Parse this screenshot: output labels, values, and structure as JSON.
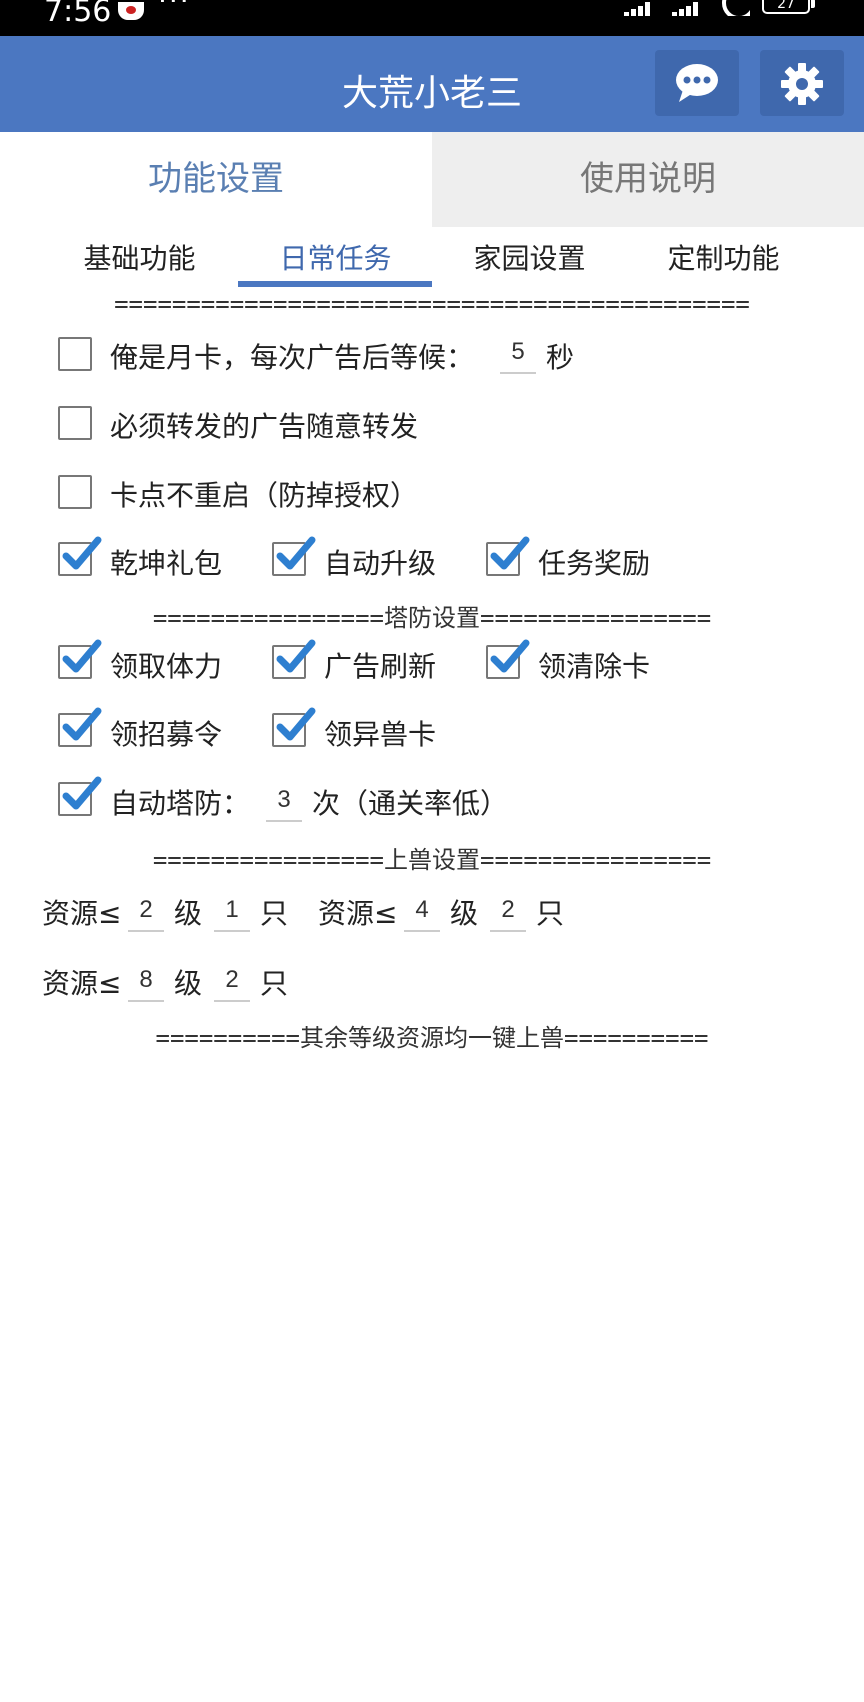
{
  "status": {
    "time": "7:56",
    "more": "···",
    "battery": "27"
  },
  "app": {
    "title": "大荒小老三",
    "chat_icon": "chat-bubble-icon",
    "settings_icon": "gear-icon"
  },
  "colors": {
    "app_bar": "#4b77c1",
    "accent": "#4b77c1",
    "check": "#2e7fd0"
  },
  "top_tabs": [
    {
      "label": "功能设置",
      "active": true
    },
    {
      "label": "使用说明",
      "active": false
    }
  ],
  "sub_tabs": [
    {
      "label": "基础功能",
      "active": false
    },
    {
      "label": "日常任务",
      "active": true
    },
    {
      "label": "家园设置",
      "active": false
    },
    {
      "label": "定制功能",
      "active": false
    }
  ],
  "separator_top": "============================================",
  "options": {
    "monthly_card": {
      "label": "俺是月卡，每次广告后等候：",
      "value": "5",
      "unit": "秒",
      "checked": false
    },
    "forward_ads": {
      "label": "必须转发的广告随意转发",
      "checked": false
    },
    "no_restart": {
      "label": "卡点不重启（防掉授权）",
      "checked": false
    },
    "qiankun": {
      "label": "乾坤礼包",
      "checked": true
    },
    "auto_upgrade": {
      "label": "自动升级",
      "checked": true
    },
    "task_reward": {
      "label": "任务奖励",
      "checked": true
    }
  },
  "tower_separator": "================塔防设置================",
  "tower": {
    "stamina": {
      "label": "领取体力",
      "checked": true
    },
    "ad_refresh": {
      "label": "广告刷新",
      "checked": true
    },
    "clear_card": {
      "label": "领清除卡",
      "checked": true
    },
    "recruit": {
      "label": "领招募令",
      "checked": true
    },
    "beast_card": {
      "label": "领异兽卡",
      "checked": true
    },
    "auto_tower": {
      "label": "自动塔防：",
      "value": "3",
      "unit": "次（通关率低）",
      "checked": true
    }
  },
  "beast_separator": "================上兽设置================",
  "beast": {
    "res_label": "资源≤",
    "level_unit": "级",
    "count_unit": "只",
    "row1": [
      {
        "level": "2",
        "count": "1"
      },
      {
        "level": "4",
        "count": "2"
      }
    ],
    "row2": [
      {
        "level": "8",
        "count": "2"
      }
    ]
  },
  "footer_separator": "==========其余等级资源均一键上兽=========="
}
